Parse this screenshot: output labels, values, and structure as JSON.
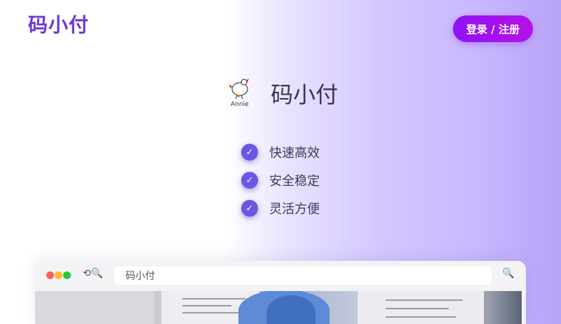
{
  "header": {
    "brand": "码小付",
    "login_button": "登录 / 注册"
  },
  "hero": {
    "logo_caption": "Annie",
    "title": "码小付",
    "features": [
      "快速高效",
      "安全稳定",
      "灵活方便"
    ]
  },
  "browser": {
    "nav_icons": "⟲🔍",
    "url_text": "码小付",
    "search_icon_glyph": "🔍"
  },
  "colors": {
    "brand": "#6b36d6",
    "button": "#9b12f0",
    "check": "#6a57e3",
    "dot_red": "#ff5f57",
    "dot_yellow": "#febc2e",
    "dot_green": "#28c840"
  }
}
